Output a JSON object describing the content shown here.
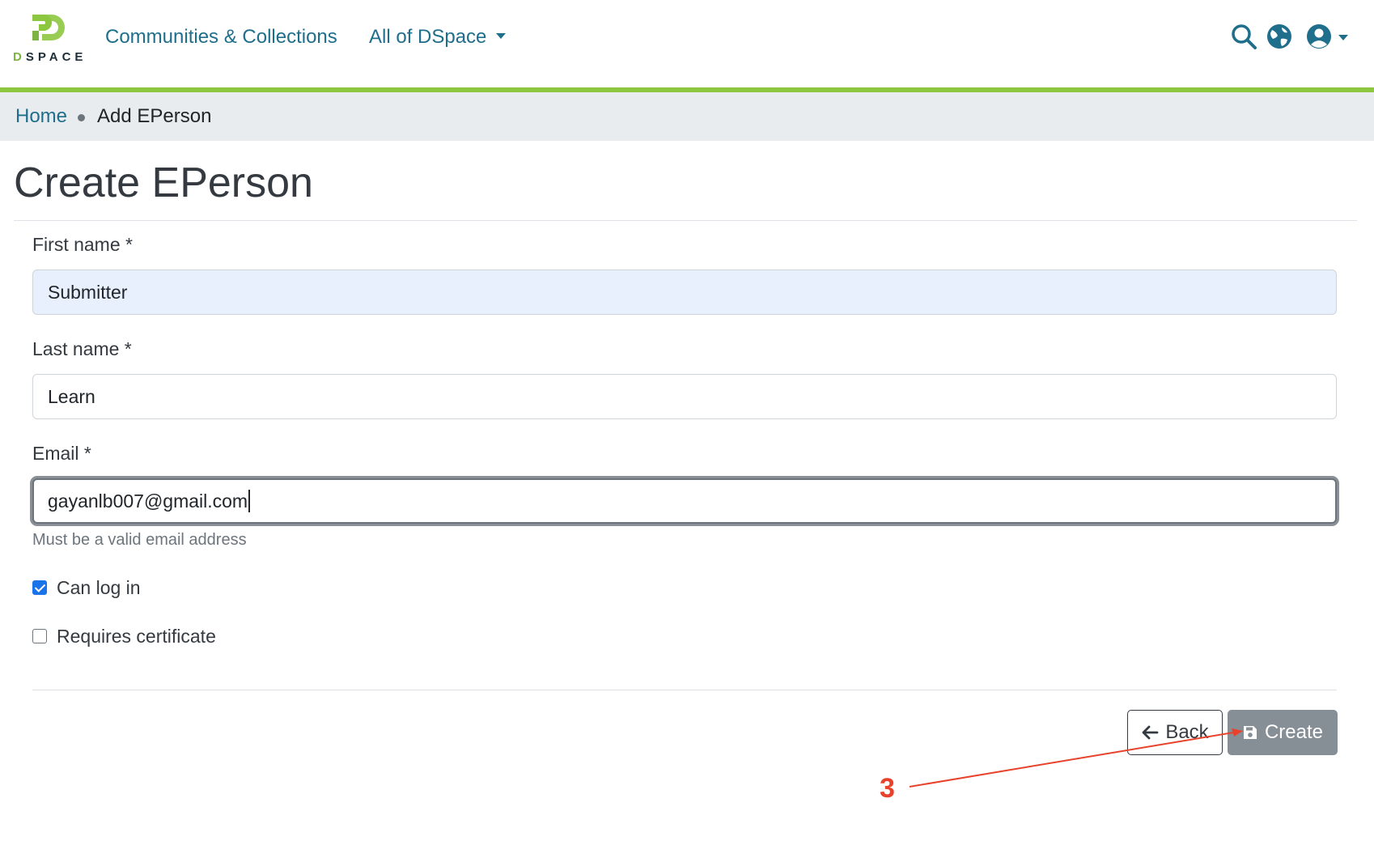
{
  "header": {
    "logo_text": "DSPACE",
    "nav": {
      "communities_label": "Communities & Collections",
      "all_label": "All of DSpace"
    },
    "icons": [
      "search-icon",
      "globe-icon",
      "user-icon"
    ]
  },
  "breadcrumb": {
    "home": "Home",
    "current": "Add EPerson"
  },
  "page": {
    "title": "Create EPerson"
  },
  "form": {
    "first_name": {
      "label": "First name *",
      "value": "Submitter"
    },
    "last_name": {
      "label": "Last name *",
      "value": "Learn"
    },
    "email": {
      "label": "Email *",
      "value": "gayanlb007@gmail.com",
      "help": "Must be a valid email address"
    },
    "can_log_in": {
      "label": "Can log in",
      "checked": true
    },
    "requires_certificate": {
      "label": "Requires certificate",
      "checked": false
    }
  },
  "actions": {
    "back_label": "Back",
    "create_label": "Create"
  },
  "annotation": {
    "step_number": "3",
    "color": "#e8412c"
  },
  "colors": {
    "brand_green": "#8dc63f",
    "link_blue": "#1f6e8c",
    "checkbox_blue": "#1a73e8",
    "create_button": "#868e96"
  }
}
